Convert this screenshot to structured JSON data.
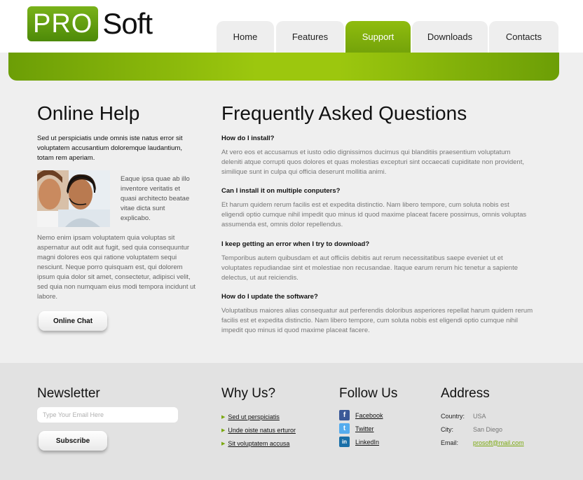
{
  "logo": {
    "pro": "PRO",
    "soft": "Soft"
  },
  "nav": [
    {
      "label": "Home",
      "active": false
    },
    {
      "label": "Features",
      "active": false
    },
    {
      "label": "Support",
      "active": true
    },
    {
      "label": "Downloads",
      "active": false
    },
    {
      "label": "Contacts",
      "active": false
    }
  ],
  "online_help": {
    "title": "Online Help",
    "intro": "Sed ut perspiciatis unde omnis iste natus error sit voluptatem accusantium doloremque laudantium, totam rem aperiam.",
    "photo_side": "Eaque ipsa quae ab illo inventore veritatis et quasi architecto beatae vitae dicta sunt explicabo.",
    "body": "Nemo enim ipsam voluptatem quia voluptas sit aspernatur aut odit aut fugit, sed quia consequuntur magni dolores eos qui ratione voluptatem sequi nesciunt. Neque porro quisquam est, qui dolorem ipsum quia dolor sit amet, consectetur, adipisci velit, sed quia non numquam eius modi tempora incidunt ut labore.",
    "chat_button": "Online Chat"
  },
  "faq": {
    "title": "Frequently Asked Questions",
    "items": [
      {
        "q": "How do I install?",
        "a": "At vero eos et accusamus et iusto odio dignissimos ducimus qui blanditiis praesentium voluptatum deleniti atque corrupti quos dolores et quas molestias excepturi sint occaecati cupiditate non provident, similique sunt in culpa qui officia deserunt mollitia animi."
      },
      {
        "q": "Can I install it on multiple conputers?",
        "a": "Et harum quidem rerum facilis est et expedita distinctio. Nam libero tempore, cum soluta nobis est eligendi optio cumque nihil impedit quo minus id quod maxime placeat facere possimus, omnis voluptas assumenda est, omnis dolor repellendus."
      },
      {
        "q": "I keep getting an error when I try to download?",
        "a": "Temporibus autem quibusdam et aut officiis debitis aut rerum necessitatibus saepe eveniet ut et voluptates repudiandae sint et molestiae non recusandae. Itaque earum rerum hic tenetur a sapiente delectus, ut aut reiciendis."
      },
      {
        "q": "How do I update the software?",
        "a": "Voluptatibus maiores alias consequatur aut perferendis doloribus asperiores repellat harum quidem rerum facilis est et expedita distinctio. Nam libero tempore, cum soluta nobis est eligendi optio cumque nihil impedit quo minus id quod maxime placeat facere."
      }
    ]
  },
  "newsletter": {
    "title": "Newsletter",
    "placeholder": "Type Your Email Here",
    "button": "Subscribe"
  },
  "why_us": {
    "title": "Why Us?",
    "links": [
      "Sed ut perspiciatis",
      "Unde oiste natus erturor",
      "Sit voluptatem accusa"
    ]
  },
  "follow_us": {
    "title": "Follow Us",
    "links": [
      {
        "label": "Facebook",
        "icon": "facebook-icon",
        "color": "#3b5998",
        "glyph": "f"
      },
      {
        "label": "Twitter",
        "icon": "twitter-icon",
        "color": "#55acee",
        "glyph": "t"
      },
      {
        "label": "LinkedIn",
        "icon": "linkedin-icon",
        "color": "#1a6fa8",
        "glyph": "in"
      }
    ]
  },
  "address": {
    "title": "Address",
    "country_label": "Country:",
    "country": "USA",
    "city_label": "City:",
    "city": "San Diego",
    "email_label": "Email:",
    "email": "prosoft@mail.com"
  },
  "colors": {
    "accent": "#8cba0c",
    "accent_dark": "#6c9e06",
    "background": "#efefef",
    "footer": "#e2e2e2"
  }
}
